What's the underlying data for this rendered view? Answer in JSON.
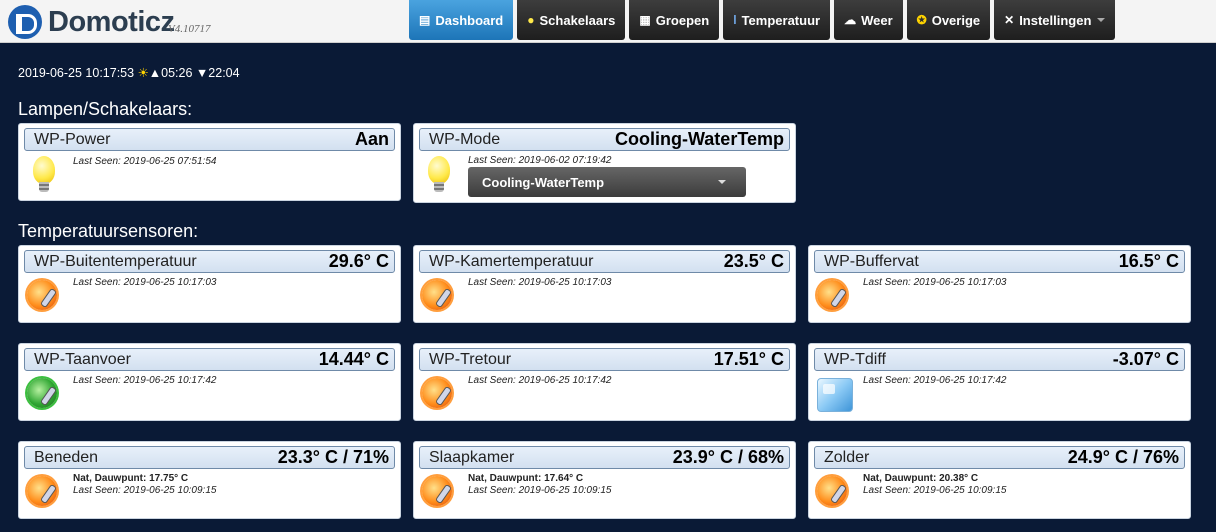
{
  "app": {
    "name": "Domoticz",
    "version": "V4.10717"
  },
  "nav": [
    {
      "label": "Dashboard",
      "icon": "dashboard-icon",
      "active": true
    },
    {
      "label": "Schakelaars",
      "icon": "bulb-icon"
    },
    {
      "label": "Groepen",
      "icon": "film-icon"
    },
    {
      "label": "Temperatuur",
      "icon": "thermometer-icon"
    },
    {
      "label": "Weer",
      "icon": "cloud-icon"
    },
    {
      "label": "Overige",
      "icon": "misc-icon"
    },
    {
      "label": "Instellingen",
      "icon": "wrench-icon"
    }
  ],
  "status": {
    "datetime": "2019-06-25 10:17:53",
    "sunrise": "▲05:26",
    "sunset": "▼22:04"
  },
  "sections": {
    "lights": "Lampen/Schakelaars:",
    "temps": "Temperatuursensoren:"
  },
  "lights": [
    {
      "name": "WP-Power",
      "value": "Aan",
      "last_seen": "Last Seen: 2019-06-25 07:51:54"
    },
    {
      "name": "WP-Mode",
      "value": "Cooling-WaterTemp",
      "last_seen": "Last Seen: 2019-06-02 07:19:42",
      "select": "Cooling-WaterTemp"
    }
  ],
  "temps": [
    {
      "name": "WP-Buitentemperatuur",
      "value": "29.6° C",
      "last_seen": "Last Seen: 2019-06-25 10:17:03"
    },
    {
      "name": "WP-Kamertemperatuur",
      "value": "23.5° C",
      "last_seen": "Last Seen: 2019-06-25 10:17:03"
    },
    {
      "name": "WP-Buffervat",
      "value": "16.5° C",
      "last_seen": "Last Seen: 2019-06-25 10:17:03"
    },
    {
      "name": "WP-Taanvoer",
      "value": "14.44° C",
      "last_seen": "Last Seen: 2019-06-25 10:17:42"
    },
    {
      "name": "WP-Tretour",
      "value": "17.51° C",
      "last_seen": "Last Seen: 2019-06-25 10:17:42"
    },
    {
      "name": "WP-Tdiff",
      "value": "-3.07° C",
      "last_seen": "Last Seen: 2019-06-25 10:17:42"
    },
    {
      "name": "Beneden",
      "value": "23.3° C / 71%",
      "extra": "Nat, Dauwpunt: 17.75° C",
      "last_seen": "Last Seen: 2019-06-25 10:09:15"
    },
    {
      "name": "Slaapkamer",
      "value": "23.9° C / 68%",
      "extra": "Nat, Dauwpunt: 17.64° C",
      "last_seen": "Last Seen: 2019-06-25 10:09:15"
    },
    {
      "name": "Zolder",
      "value": "24.9° C / 76%",
      "extra": "Nat, Dauwpunt: 20.38° C",
      "last_seen": "Last Seen: 2019-06-25 10:09:15"
    }
  ]
}
